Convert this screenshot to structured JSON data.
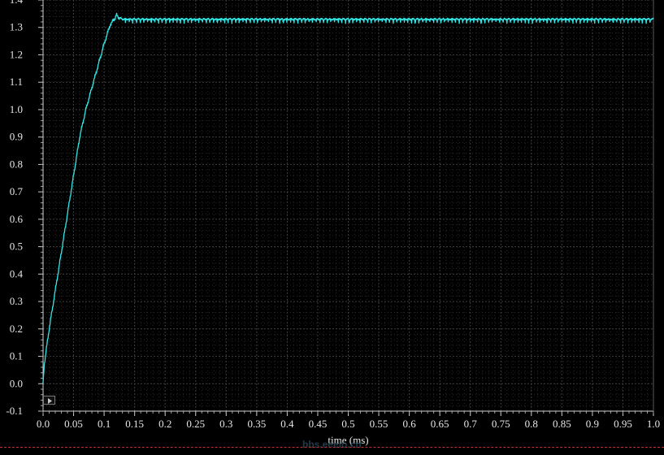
{
  "chart_data": {
    "type": "line",
    "title": "",
    "xlabel": "time (ms)",
    "ylabel": "",
    "xlim": [
      0.0,
      1.0
    ],
    "ylim": [
      -0.1,
      1.4
    ],
    "x_ticks": [
      "0.0",
      "0.05",
      "0.1",
      "0.15",
      "0.2",
      "0.25",
      "0.3",
      "0.35",
      "0.4",
      "0.45",
      "0.5",
      "0.55",
      "0.6",
      "0.65",
      "0.7",
      "0.75",
      "0.8",
      "0.85",
      "0.9",
      "0.95",
      "1.0"
    ],
    "y_ticks": [
      "-0.1",
      "0.0",
      "0.1",
      "0.2",
      "0.3",
      "0.4",
      "0.5",
      "0.6",
      "0.7",
      "0.8",
      "0.9",
      "1.0",
      "1.1",
      "1.2",
      "1.3",
      "1.4"
    ],
    "grid": true,
    "series": [
      {
        "color": "#33e6e6",
        "x": [
          0.0,
          0.002,
          0.005,
          0.01,
          0.02,
          0.03,
          0.04,
          0.05,
          0.06,
          0.07,
          0.08,
          0.09,
          0.1,
          0.11,
          0.117,
          0.12,
          0.125,
          0.13,
          0.15,
          0.2,
          0.25,
          0.3,
          0.35,
          0.4,
          0.45,
          0.5,
          0.55,
          0.6,
          0.65,
          0.7,
          0.75,
          0.8,
          0.85,
          0.9,
          0.95,
          1.0
        ],
        "y": [
          0.0,
          0.07,
          0.12,
          0.2,
          0.34,
          0.48,
          0.62,
          0.76,
          0.9,
          1.0,
          1.08,
          1.16,
          1.24,
          1.31,
          1.33,
          1.345,
          1.335,
          1.33,
          1.33,
          1.33,
          1.33,
          1.33,
          1.33,
          1.33,
          1.33,
          1.33,
          1.33,
          1.33,
          1.33,
          1.33,
          1.33,
          1.33,
          1.33,
          1.33,
          1.33,
          1.33
        ]
      }
    ]
  },
  "watermark": "bbs.eeeio.cn"
}
